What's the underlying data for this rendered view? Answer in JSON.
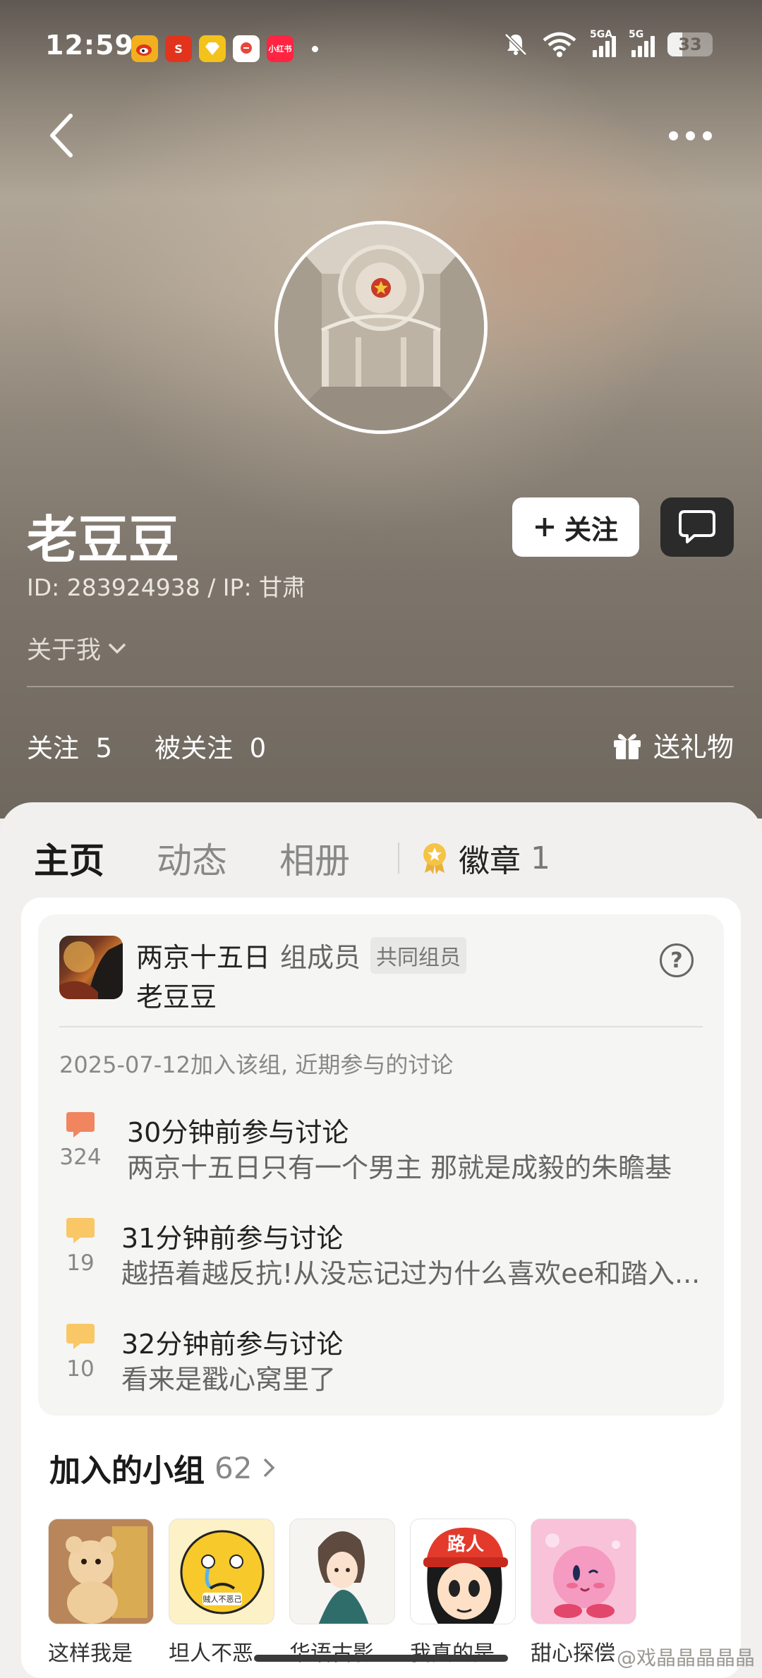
{
  "status_bar": {
    "time": "12:59",
    "app_icons": [
      {
        "name": "weibo",
        "label": "",
        "color": "#f2b01e"
      },
      {
        "name": "app-s",
        "label": "S",
        "color": "#e2341d"
      },
      {
        "name": "app-diamond",
        "label": "",
        "color": "#f3c21b"
      },
      {
        "name": "app-red-white",
        "label": "",
        "color": "#ffffff"
      },
      {
        "name": "xiaohongshu",
        "label": "小红书",
        "color": "#ff2442"
      }
    ],
    "net1_label": "5GA",
    "net2_label": "5G",
    "battery": "33",
    "battery_level": 0.33
  },
  "profile": {
    "name": "老豆豆",
    "id_line": "ID: 283924938 / IP: 甘肃",
    "about": "关于我",
    "follow_label": "关注",
    "following_label": "关注",
    "following_count": "5",
    "followers_label": "被关注",
    "followers_count": "0",
    "gift_label": "送礼物"
  },
  "tabs": [
    {
      "label": "主页",
      "active": true
    },
    {
      "label": "动态",
      "active": false
    },
    {
      "label": "相册",
      "active": false
    }
  ],
  "badge_tab": {
    "label": "徽章",
    "count": "1"
  },
  "group_card": {
    "group": "两京十五日",
    "role": "组成员",
    "chip": "共同组员",
    "member": "老豆豆",
    "help": "?",
    "joined": "2025-07-12加入该组, 近期参与的讨论",
    "discussions": [
      {
        "when": "30分钟前参与讨论",
        "count": "324",
        "text": "两京十五日只有一个男主 那就是成毅的朱瞻基",
        "color": "#f08560"
      },
      {
        "when": "31分钟前参与讨论",
        "count": "19",
        "text": "越捂着越反抗!从没忘记过为什么喜欢ee和踏入...",
        "color": "#f9c766"
      },
      {
        "when": "32分钟前参与讨论",
        "count": "10",
        "text": "看来是戳心窝里了",
        "color": "#f9c766"
      }
    ]
  },
  "joined_groups": {
    "title": "加入的小组",
    "count": "62",
    "items": [
      {
        "label": "这样我是",
        "bg": "#c89a6b"
      },
      {
        "label": "坦人不恶",
        "bg": "#fbe8a8"
      },
      {
        "label": "华语古影",
        "bg": "#f2f0ec"
      },
      {
        "label": "我真的是",
        "bg": "#fff5ee"
      },
      {
        "label": "甜心探偿",
        "bg": "#f4a3c8"
      }
    ],
    "sticker_text_2": "贼人不恶己",
    "sticker_text_4": "路人"
  },
  "watermark": "@戏晶晶晶晶晶"
}
